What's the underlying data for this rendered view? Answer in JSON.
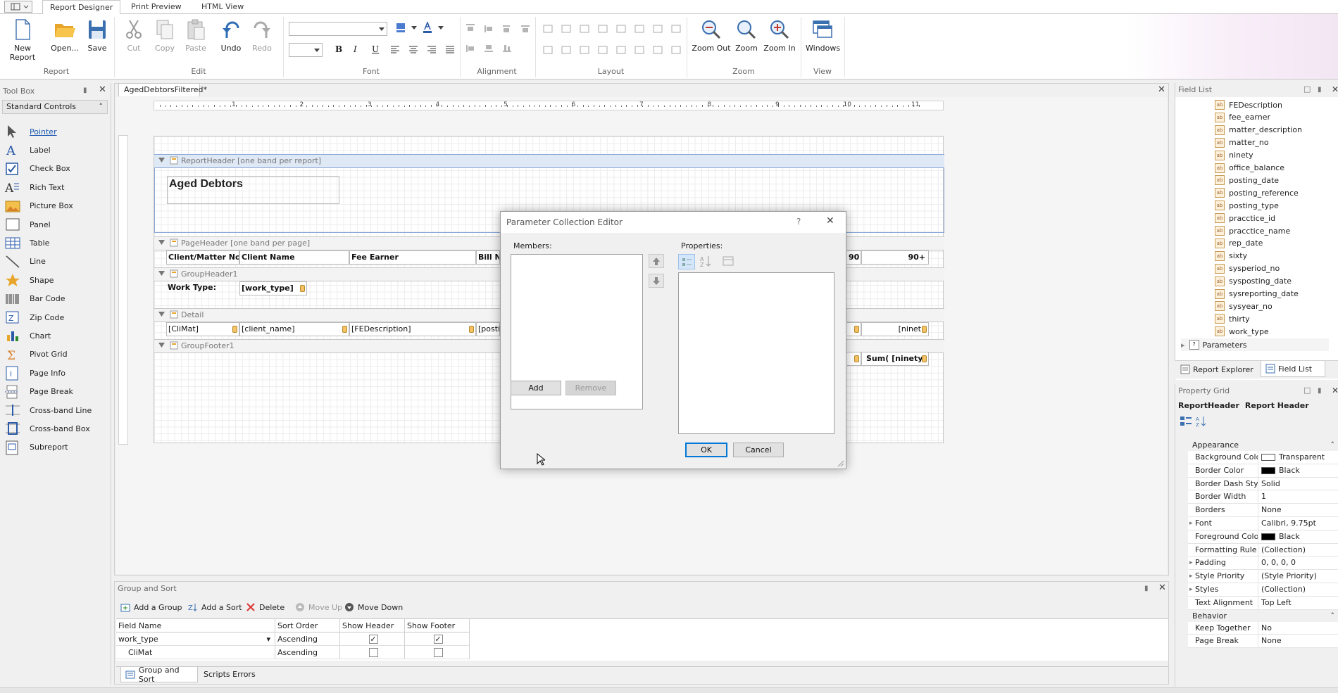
{
  "ribbon": {
    "tabs": [
      "Report Designer",
      "Print Preview",
      "HTML View"
    ],
    "groups": {
      "report": {
        "label": "Report",
        "buttons": [
          "New Report",
          "Open...",
          "Save"
        ]
      },
      "edit": {
        "label": "Edit",
        "buttons": [
          "Cut",
          "Copy",
          "Paste",
          "Undo",
          "Redo"
        ]
      },
      "font": {
        "label": "Font",
        "bold": "B",
        "italic": "I",
        "underline": "U"
      },
      "alignment": {
        "label": "Alignment"
      },
      "layout": {
        "label": "Layout"
      },
      "zoom": {
        "label": "Zoom",
        "buttons": [
          "Zoom Out",
          "Zoom",
          "Zoom In"
        ]
      },
      "view": {
        "label": "View",
        "buttons": [
          "Windows"
        ]
      }
    }
  },
  "toolbox": {
    "title": "Tool Box",
    "category": "Standard Controls",
    "items": [
      {
        "label": "Pointer",
        "icon": "pointer-icon"
      },
      {
        "label": "Label",
        "icon": "label-icon"
      },
      {
        "label": "Check Box",
        "icon": "checkbox-icon"
      },
      {
        "label": "Rich Text",
        "icon": "rich-text-icon"
      },
      {
        "label": "Picture Box",
        "icon": "picture-icon"
      },
      {
        "label": "Panel",
        "icon": "panel-icon"
      },
      {
        "label": "Table",
        "icon": "table-icon"
      },
      {
        "label": "Line",
        "icon": "line-icon"
      },
      {
        "label": "Shape",
        "icon": "shape-icon"
      },
      {
        "label": "Bar Code",
        "icon": "barcode-icon"
      },
      {
        "label": "Zip Code",
        "icon": "zipcode-icon"
      },
      {
        "label": "Chart",
        "icon": "chart-icon"
      },
      {
        "label": "Pivot Grid",
        "icon": "pivot-icon"
      },
      {
        "label": "Page Info",
        "icon": "page-info-icon"
      },
      {
        "label": "Page Break",
        "icon": "page-break-icon"
      },
      {
        "label": "Cross-band Line",
        "icon": "cross-band-line-icon"
      },
      {
        "label": "Cross-band Box",
        "icon": "cross-band-box-icon"
      },
      {
        "label": "Subreport",
        "icon": "subreport-icon"
      }
    ]
  },
  "document": {
    "tab": "AgedDebtorsFiltered*",
    "ruler_numbers": [
      "1",
      "2",
      "3",
      "4",
      "5",
      "6",
      "7",
      "8",
      "9",
      "10",
      "11"
    ],
    "bands": {
      "report_header": "ReportHeader [one band per report]",
      "page_header": "PageHeader [one band per page]",
      "group_header": "GroupHeader1",
      "detail": "Detail",
      "group_footer": "GroupFooter1"
    },
    "title": "Aged Debtors",
    "page_header_cells": [
      "Client/Matter No",
      "Client Name",
      "Fee Earner",
      "Bill No",
      "90",
      "90+"
    ],
    "group_header_cells": [
      "Work Type:",
      "[work_type]"
    ],
    "detail_cells": [
      "[CliMat]",
      "[client_name]",
      "[FEDescription]",
      "[posti",
      "[ninet"
    ],
    "group_footer_cells": [
      "Sum( [ninety]"
    ]
  },
  "dialog": {
    "title": "Parameter Collection Editor",
    "help": "?",
    "members_label": "Members:",
    "properties_label": "Properties:",
    "add": "Add",
    "remove": "Remove",
    "ok": "OK",
    "cancel": "Cancel"
  },
  "field_list": {
    "title": "Field List",
    "fields": [
      "FEDescription",
      "fee_earner",
      "matter_description",
      "matter_no",
      "ninety",
      "office_balance",
      "posting_date",
      "posting_reference",
      "posting_type",
      "pracctice_id",
      "pracctice_name",
      "rep_date",
      "sixty",
      "sysperiod_no",
      "sysposting_date",
      "sysreporting_date",
      "sysyear_no",
      "thirty",
      "work_type"
    ],
    "parameters": "Parameters",
    "tabs": [
      "Report Explorer",
      "Field List"
    ]
  },
  "property_grid": {
    "title": "Property Grid",
    "selected": "ReportHeader",
    "selected_type": "Report Header",
    "categories": [
      {
        "name": "Appearance",
        "rows": [
          {
            "name": "Background Colo",
            "value": "Transparent",
            "swatch": "#ffffff"
          },
          {
            "name": "Border Color",
            "value": "Black",
            "swatch": "#000000"
          },
          {
            "name": "Border Dash Sty",
            "value": "Solid"
          },
          {
            "name": "Border Width",
            "value": "1"
          },
          {
            "name": "Borders",
            "value": "None"
          },
          {
            "name": "Font",
            "value": "Calibri, 9.75pt",
            "expand": true
          },
          {
            "name": "Foreground Colo",
            "value": "Black",
            "swatch": "#000000"
          },
          {
            "name": "Formatting Rule",
            "value": "(Collection)"
          },
          {
            "name": "Padding",
            "value": "0, 0, 0, 0",
            "expand": true
          },
          {
            "name": "Style Priority",
            "value": "(Style Priority)",
            "expand": true
          },
          {
            "name": "Styles",
            "value": "(Collection)",
            "expand": true
          },
          {
            "name": "Text Alignment",
            "value": "Top Left"
          }
        ]
      },
      {
        "name": "Behavior",
        "rows": [
          {
            "name": "Keep Together",
            "value": "No"
          },
          {
            "name": "Page Break",
            "value": "None"
          }
        ]
      }
    ]
  },
  "group_sort": {
    "title": "Group and Sort",
    "toolbar": [
      "Add a Group",
      "Add a Sort",
      "Delete",
      "Move Up",
      "Move Down"
    ],
    "columns": [
      "Field Name",
      "Sort Order",
      "Show Header",
      "Show Footer"
    ],
    "rows": [
      {
        "field": "work_type",
        "order": "Ascending",
        "header": true,
        "footer": true
      },
      {
        "field": "CliMat",
        "order": "Ascending",
        "header": false,
        "footer": false
      }
    ],
    "tabs": [
      "Group and Sort",
      "Scripts Errors"
    ]
  }
}
